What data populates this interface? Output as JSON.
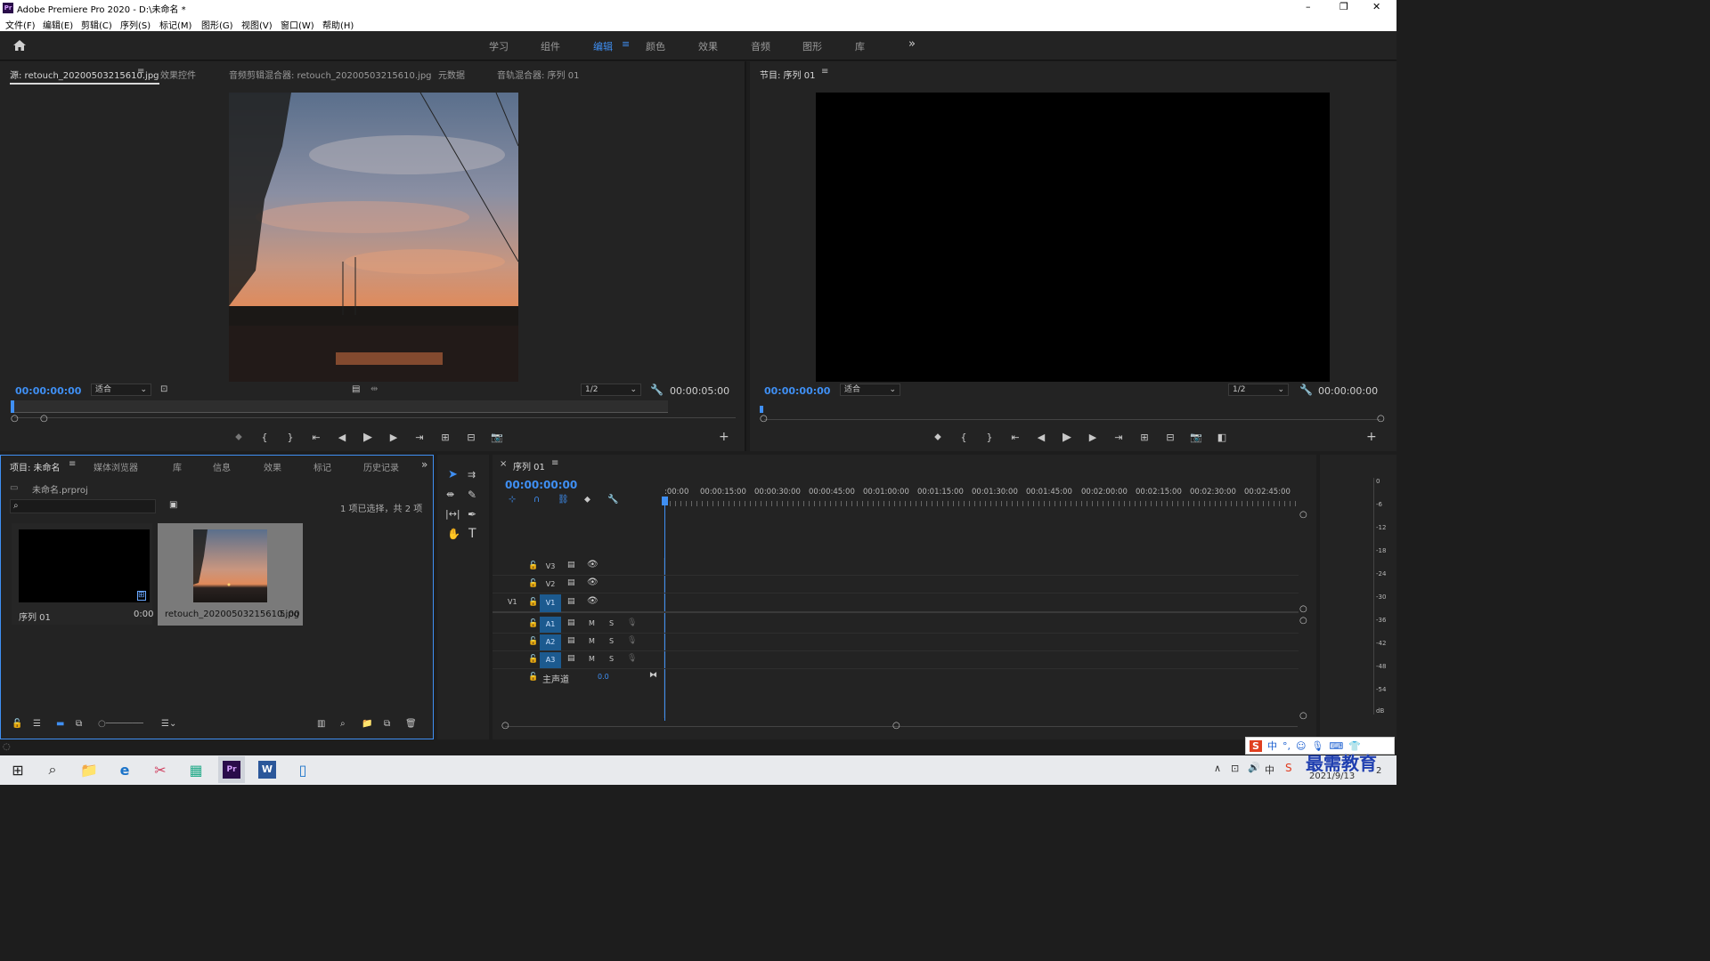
{
  "window": {
    "app_title": "Adobe Premiere Pro 2020 - D:\\未命名 *",
    "minimize": "–",
    "maximize": "❐",
    "close": "✕"
  },
  "menu": [
    "文件(F)",
    "编辑(E)",
    "剪辑(C)",
    "序列(S)",
    "标记(M)",
    "图形(G)",
    "视图(V)",
    "窗口(W)",
    "帮助(H)"
  ],
  "workspaces": [
    "学习",
    "组件",
    "编辑",
    "颜色",
    "效果",
    "音频",
    "图形",
    "库"
  ],
  "workspace_active": "编辑",
  "source_panel": {
    "tabs": [
      "源: retouch_20200503215610.jpg",
      "效果控件",
      "音频剪辑混合器: retouch_20200503215610.jpg",
      "元数据",
      "音轨混合器: 序列 01"
    ],
    "timecode": "00:00:00:00",
    "fit": "适合",
    "resolution": "1/2",
    "duration": "00:00:05:00"
  },
  "program_panel": {
    "title": "节目: 序列 01",
    "timecode": "00:00:00:00",
    "fit": "适合",
    "resolution": "1/2",
    "duration": "00:00:00:00"
  },
  "project_panel": {
    "tabs": [
      "项目: 未命名",
      "媒体浏览器",
      "库",
      "信息",
      "效果",
      "标记",
      "历史记录"
    ],
    "file": "未命名.prproj",
    "selection_info": "1 项已选择，共 2 项",
    "items": [
      {
        "name": "序列 01",
        "duration": "0:00"
      },
      {
        "name": "retouch_20200503215610.jpg",
        "duration": "5:00"
      }
    ]
  },
  "timeline": {
    "tab": "序列 01",
    "close": "×",
    "timecode": "00:00:00:00",
    "ruler": [
      ":00:00",
      "00:00:15:00",
      "00:00:30:00",
      "00:00:45:00",
      "00:01:00:00",
      "00:01:15:00",
      "00:01:30:00",
      "00:01:45:00",
      "00:02:00:00",
      "00:02:15:00",
      "00:02:30:00",
      "00:02:45:00"
    ],
    "video_tracks": [
      "V3",
      "V2",
      "V1"
    ],
    "source_patch": "V1",
    "audio_tracks": [
      "A1",
      "A2",
      "A3"
    ],
    "mute": "M",
    "solo": "S",
    "master": {
      "label": "主声道",
      "value": "0.0"
    }
  },
  "audio_meter": {
    "scale": [
      "0",
      "-6",
      "-12",
      "-18",
      "-24",
      "-30",
      "-36",
      "-42",
      "-48",
      "-54",
      "dB"
    ]
  },
  "taskbar": {
    "date": "2021/9/13",
    "watermark": "最需教育",
    "ime": "中",
    "notify_count": "2"
  }
}
